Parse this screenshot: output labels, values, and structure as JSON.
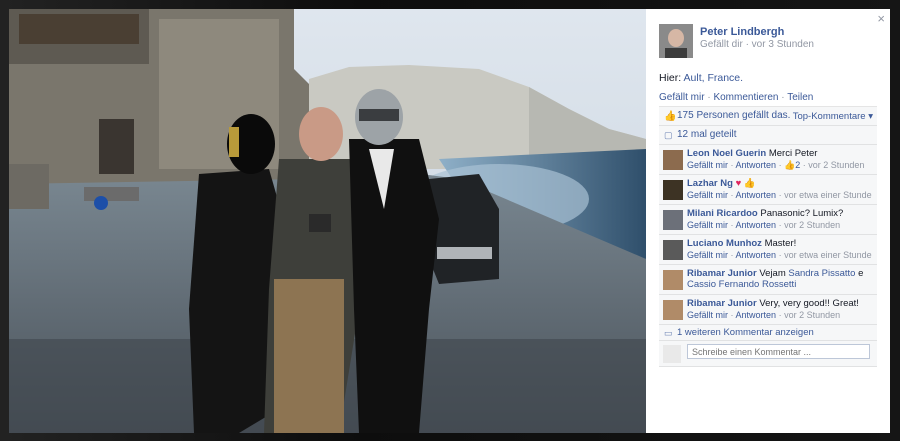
{
  "panel": {
    "close_icon": "×",
    "author": {
      "name": "Peter Lindbergh",
      "meta": "Gefällt dir · vor 3 Stunden"
    },
    "location_prefix": "Hier: ",
    "location_link": "Ault, France.",
    "actions": [
      "Gefällt mir",
      "Kommentieren",
      "Teilen"
    ],
    "likes": {
      "text": "175 Personen gefällt das.",
      "sort_label": "Top-Kommentare ▾"
    },
    "shares": {
      "text": "12 mal geteilt"
    },
    "comments": [
      {
        "name": "Leon Noel Guerin",
        "text": "Merci Peter",
        "actions": [
          "Gefällt mir",
          "Antworten"
        ],
        "likes": "2",
        "time": "vor 2 Stunden"
      },
      {
        "name": "Lazhar Ng",
        "text": "",
        "reactions": [
          "heart-icon",
          "thumbs-up-icon"
        ],
        "actions": [
          "Gefällt mir",
          "Antworten"
        ],
        "time": "vor etwa einer Stunde"
      },
      {
        "name": "Milani Ricardoo",
        "text": "Panasonic? Lumix?",
        "actions": [
          "Gefällt mir",
          "Antworten"
        ],
        "time": "vor 2 Stunden"
      },
      {
        "name": "Luciano Munhoz",
        "text": "Master!",
        "actions": [
          "Gefällt mir",
          "Antworten"
        ],
        "time": "vor etwa einer Stunde"
      },
      {
        "name": "Ribamar Junior",
        "text": "Vejam",
        "mention1": "Sandra Pissatto",
        "joiner": "e",
        "mention2": "Cassio Fernando Rossetti",
        "actions": [
          "Gefällt mir",
          "Antworten"
        ],
        "time": "vor 2 Stunden"
      },
      {
        "name": "Ribamar Junior",
        "text": "Very, very good!! Great!",
        "actions": [
          "Gefällt mir",
          "Antworten"
        ],
        "time": "vor 2 Stunden"
      }
    ],
    "more_comments": "1 weiteren Kommentar anzeigen",
    "write_placeholder": "Schreibe einen Kommentar ..."
  },
  "colors": {
    "link": "#3b5998",
    "muted": "#9197a3",
    "feed_bg": "#f6f7f8",
    "heart": "#e0245e"
  }
}
